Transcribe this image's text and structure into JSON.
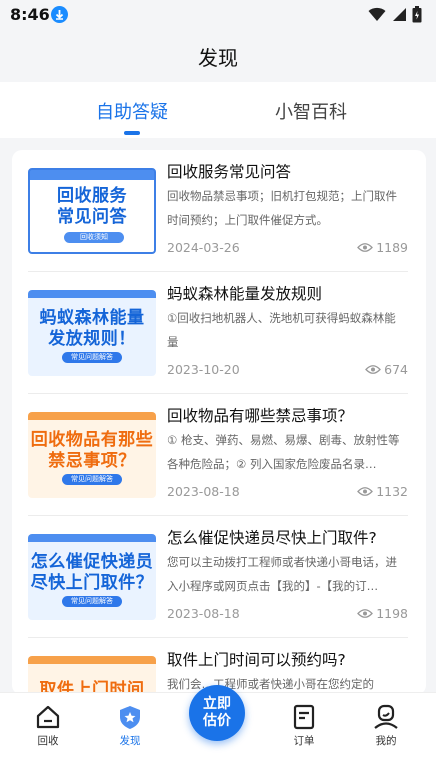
{
  "status": {
    "time": "8:46"
  },
  "header": {
    "title": "发现"
  },
  "tabs": [
    {
      "label": "自助答疑"
    },
    {
      "label": "小智百科"
    }
  ],
  "articles": [
    {
      "thumb_line1": "回收服务",
      "thumb_line2": "常见问答",
      "thumb_pill": "回收须知",
      "title": "回收服务常见问答",
      "desc": "回收物品禁忌事项；旧机打包规范；上门取件时间预约；上门取件催促方式。",
      "date": "2024-03-26",
      "views": "1189"
    },
    {
      "thumb_line1": "蚂蚁森林能量",
      "thumb_line2": "发放规则！",
      "thumb_pill": "常见问题解答",
      "title": "蚂蚁森林能量发放规则",
      "desc": "①回收扫地机器人、洗地机可获得蚂蚁森林能量",
      "date": "2023-10-20",
      "views": "674"
    },
    {
      "thumb_line1": "回收物品有那些",
      "thumb_line2": "禁忌事项？",
      "thumb_pill": "常见问题解答",
      "title": "回收物品有哪些禁忌事项？",
      "desc": "① 枪支、弹药、易燃、易爆、剧毒、放射性等各种危险品；② 列入国家危险废品名录…",
      "date": "2023-08-18",
      "views": "1132"
    },
    {
      "thumb_line1": "怎么催促快递员",
      "thumb_line2": "尽快上门取件？",
      "thumb_pill": "常见问题解答",
      "title": "怎么催促快递员尽快上门取件?",
      "desc": "您可以主动拨打工程师或者快递小哥电话，进入小程序或网页点击【我的】-【我的订…",
      "date": "2023-08-18",
      "views": "1198"
    },
    {
      "thumb_line1": "取件上门时间",
      "thumb_line2": "",
      "thumb_pill": "",
      "title": "取件上门时间可以预约吗?",
      "desc": "我们会…工程师或者快递小哥在您约定的",
      "date": "",
      "views": ""
    }
  ],
  "nav": {
    "items": [
      {
        "label": "回收",
        "icon": "home-icon"
      },
      {
        "label": "发现",
        "icon": "discover-icon"
      },
      {
        "label": "订单",
        "icon": "order-icon"
      },
      {
        "label": "我的",
        "icon": "profile-icon"
      }
    ],
    "center_line1": "立即",
    "center_line2": "估价"
  },
  "colors": {
    "accent": "#1a73e8",
    "thumb_text_blue": "#1565d8",
    "thumb_text_orange": "#ef6c0f"
  }
}
